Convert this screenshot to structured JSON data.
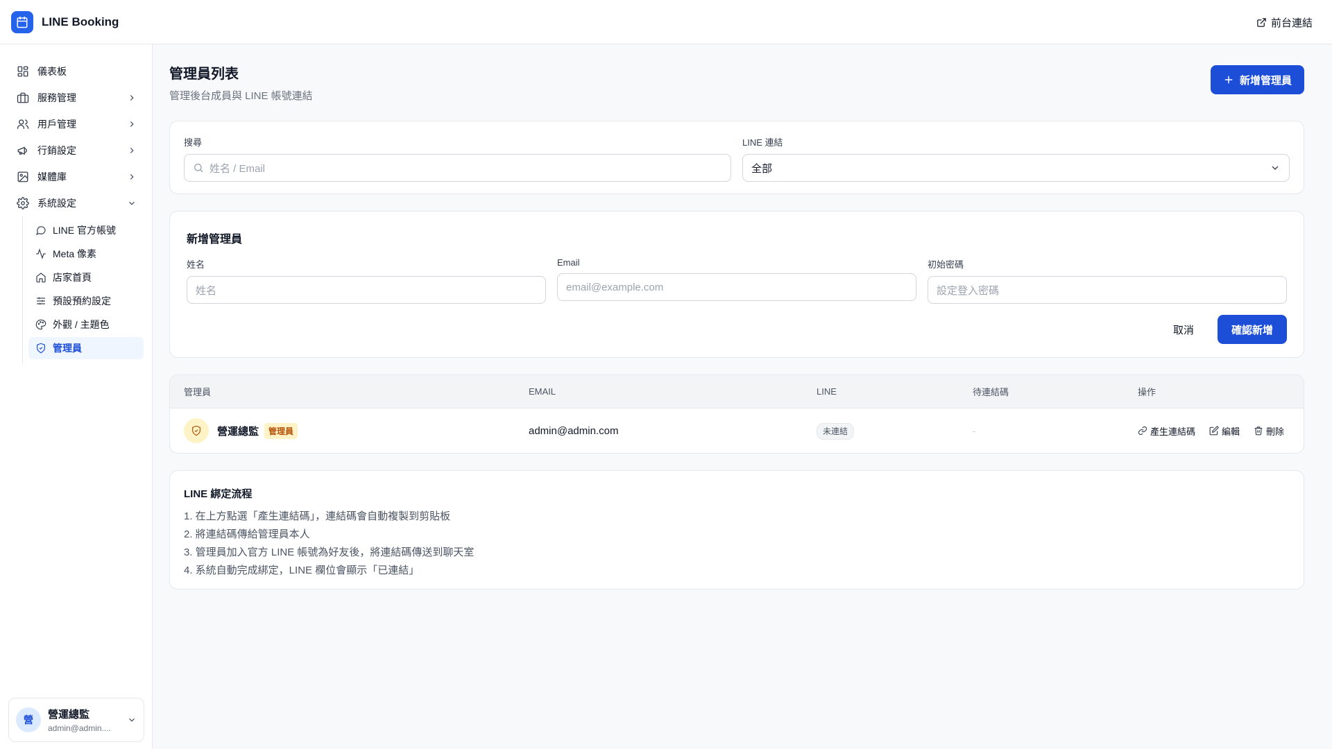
{
  "app": {
    "name": "LINE Booking",
    "front_link": "前台連結"
  },
  "sidebar": {
    "items": [
      {
        "label": "儀表板"
      },
      {
        "label": "服務管理"
      },
      {
        "label": "用戶管理"
      },
      {
        "label": "行銷設定"
      },
      {
        "label": "媒體庫"
      },
      {
        "label": "系統設定"
      }
    ],
    "sub_items": [
      {
        "label": "LINE 官方帳號"
      },
      {
        "label": "Meta 像素"
      },
      {
        "label": "店家首頁"
      },
      {
        "label": "預設預約設定"
      },
      {
        "label": "外觀 / 主題色"
      },
      {
        "label": "管理員"
      }
    ],
    "user": {
      "avatar": "營",
      "name": "營運總監",
      "email": "admin@admin...."
    }
  },
  "page": {
    "title": "管理員列表",
    "subtitle": "管理後台成員與 LINE 帳號連結",
    "add_button": "新增管理員"
  },
  "filters": {
    "search_label": "搜尋",
    "search_placeholder": "姓名 / Email",
    "line_label": "LINE 連結",
    "line_value": "全部"
  },
  "form": {
    "title": "新增管理員",
    "name_label": "姓名",
    "name_placeholder": "姓名",
    "email_label": "Email",
    "email_placeholder": "email@example.com",
    "password_label": "初始密碼",
    "password_placeholder": "設定登入密碼",
    "cancel": "取消",
    "confirm": "確認新增"
  },
  "table": {
    "headers": [
      "管理員",
      "EMAIL",
      "LINE",
      "待連結碼",
      "操作"
    ],
    "rows": [
      {
        "name": "營運總監",
        "role": "管理員",
        "email": "admin@admin.com",
        "line_status": "未連結",
        "pending_code": "-",
        "actions": [
          "產生連結碼",
          "編輯",
          "刪除"
        ]
      }
    ]
  },
  "guide": {
    "title": "LINE 綁定流程",
    "steps": [
      "1. 在上方點選「產生連結碼」，連結碼會自動複製到剪貼板",
      "2. 將連結碼傳給管理員本人",
      "3. 管理員加入官方 LINE 帳號為好友後，將連結碼傳送到聊天室",
      "4. 系統自動完成綁定，LINE 欄位會顯示「已連結」"
    ]
  },
  "colors": {
    "primary": "#1d4ed8",
    "accent_bg": "#eff6ff",
    "badge_bg": "#fef3c7",
    "badge_text": "#b45309"
  }
}
